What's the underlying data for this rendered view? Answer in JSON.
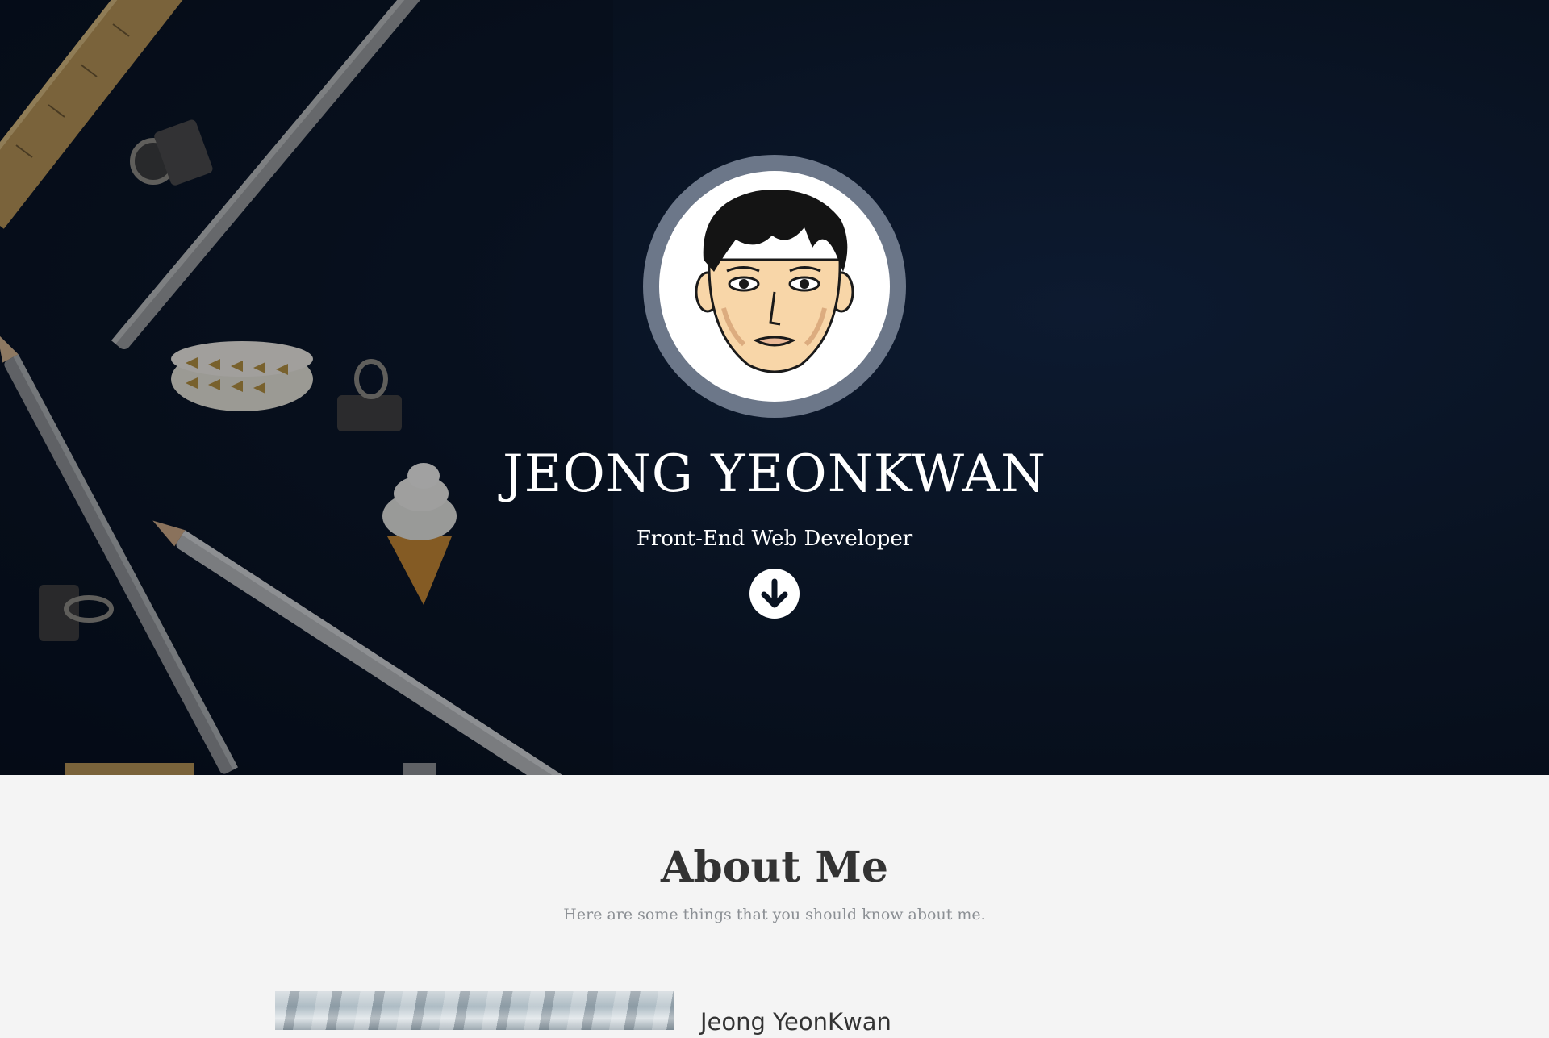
{
  "hero": {
    "name": "JEONG YEONKWAN",
    "role": "Front-End Web Developer",
    "avatar_icon": "cartoon-face-avatar",
    "scroll_icon": "arrow-down-circle-icon",
    "colors": {
      "background": "#08111f",
      "ring": "#6c7789",
      "text": "#ffffff"
    }
  },
  "about": {
    "title": "About Me",
    "subtitle": "Here are some things that you should know about me.",
    "name_heading": "Jeong YeonKwan",
    "colors": {
      "background": "#f4f4f4",
      "title": "#333333",
      "subtitle": "#8b8f94"
    }
  }
}
